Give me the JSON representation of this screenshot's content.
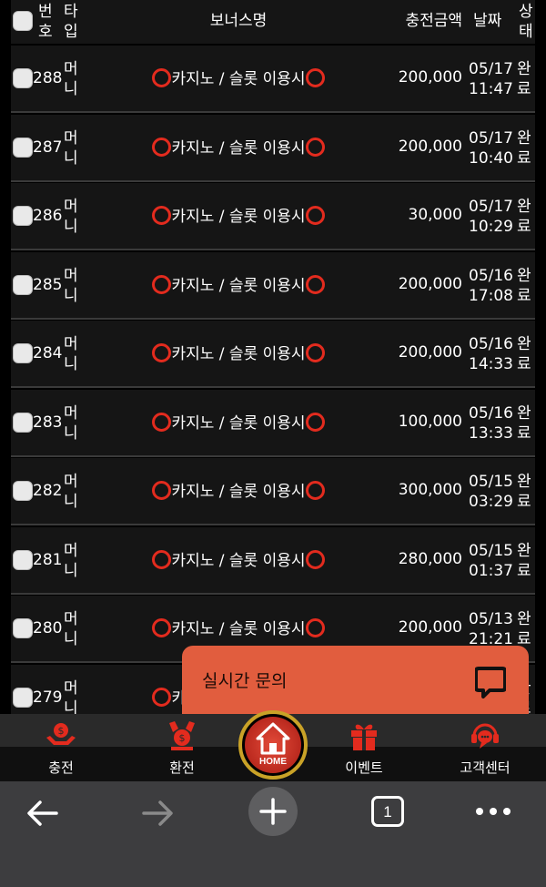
{
  "table": {
    "headers": {
      "no": "번\n호",
      "type": "타\n입",
      "bonus": "보너스명",
      "amount": "충전금액",
      "date": "날짜",
      "status": "상\n태"
    },
    "rows": [
      {
        "no": "288",
        "type": "머\n니",
        "bonus": "카지노 / 슬롯 이용시",
        "amount": "200,000",
        "date": "05/17\n11:47",
        "status": "완\n료"
      },
      {
        "no": "287",
        "type": "머\n니",
        "bonus": "카지노 / 슬롯 이용시",
        "amount": "200,000",
        "date": "05/17\n10:40",
        "status": "완\n료"
      },
      {
        "no": "286",
        "type": "머\n니",
        "bonus": "카지노 / 슬롯 이용시",
        "amount": "30,000",
        "date": "05/17\n10:29",
        "status": "완\n료"
      },
      {
        "no": "285",
        "type": "머\n니",
        "bonus": "카지노 / 슬롯 이용시",
        "amount": "200,000",
        "date": "05/16\n17:08",
        "status": "완\n료"
      },
      {
        "no": "284",
        "type": "머\n니",
        "bonus": "카지노 / 슬롯 이용시",
        "amount": "200,000",
        "date": "05/16\n14:33",
        "status": "완\n료"
      },
      {
        "no": "283",
        "type": "머\n니",
        "bonus": "카지노 / 슬롯 이용시",
        "amount": "100,000",
        "date": "05/16\n13:33",
        "status": "완\n료"
      },
      {
        "no": "282",
        "type": "머\n니",
        "bonus": "카지노 / 슬롯 이용시",
        "amount": "300,000",
        "date": "05/15\n03:29",
        "status": "완\n료"
      },
      {
        "no": "281",
        "type": "머\n니",
        "bonus": "카지노 / 슬롯 이용시",
        "amount": "280,000",
        "date": "05/15\n01:37",
        "status": "완\n료"
      },
      {
        "no": "280",
        "type": "머\n니",
        "bonus": "카지노 / 슬롯 이용시",
        "amount": "200,000",
        "date": "05/13\n21:21",
        "status": "완\n료"
      },
      {
        "no": "279",
        "type": "머\n니",
        "bonus": "카지노 / 슬롯 이용시",
        "amount": "",
        "date": "",
        "status": "완\n료"
      }
    ]
  },
  "chat": {
    "label": "실시간 문의",
    "icon": "chat-bubble-icon"
  },
  "nav": {
    "items": [
      {
        "label": "충전",
        "icon": "deposit-hand-icon"
      },
      {
        "label": "환전",
        "icon": "withdraw-hand-icon"
      },
      {
        "label": "이벤트",
        "icon": "gift-icon"
      },
      {
        "label": "고객센터",
        "icon": "headset-icon"
      }
    ],
    "home_label": "HOME"
  },
  "browser": {
    "tab_count": "1"
  },
  "colors": {
    "accent": "#e32b1e",
    "chat_bg": "#e15d3e",
    "row_bg": "#151515",
    "nav_bg": "#2a2a2a",
    "browser_bg": "#3d3d3f"
  }
}
